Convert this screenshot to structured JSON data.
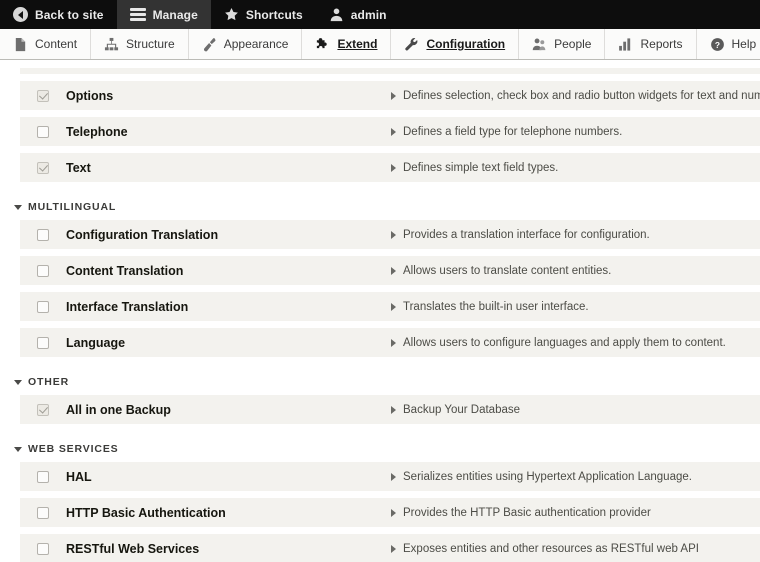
{
  "admin_bar": {
    "items": [
      {
        "label": "Back to site",
        "icon": "back-arrow-icon",
        "active": false
      },
      {
        "label": "Manage",
        "icon": "hamburger-icon",
        "active": true
      },
      {
        "label": "Shortcuts",
        "icon": "star-icon",
        "active": false
      },
      {
        "label": "admin",
        "icon": "user-icon",
        "active": false
      }
    ]
  },
  "tab_bar": {
    "items": [
      {
        "label": "Content",
        "icon": "document-icon",
        "active": false
      },
      {
        "label": "Structure",
        "icon": "sitemap-icon",
        "active": false
      },
      {
        "label": "Appearance",
        "icon": "paintbrush-icon",
        "active": false
      },
      {
        "label": "Extend",
        "icon": "puzzle-piece-icon",
        "active": true
      },
      {
        "label": "Configuration",
        "icon": "wrench-icon",
        "active": true
      },
      {
        "label": "People",
        "icon": "people-icon",
        "active": false
      },
      {
        "label": "Reports",
        "icon": "bar-chart-icon",
        "active": false
      },
      {
        "label": "Help",
        "icon": "question-mark-icon",
        "active": false
      }
    ]
  },
  "colors": {
    "admin_bar_bg": "#0d0d0d",
    "admin_bar_active_bg": "#333333",
    "tab_bar_bg": "#fbfbfa",
    "row_bg": "#f3f2ee",
    "page_bg": "#ffffff"
  },
  "modules": {
    "partial_top_row": true,
    "sections": [
      {
        "header": null,
        "rows": [
          {
            "name": "Options",
            "description": "Defines selection, check box and radio button widgets for text and numeric field",
            "checked": true,
            "disabled": true
          },
          {
            "name": "Telephone",
            "description": "Defines a field type for telephone numbers.",
            "checked": false,
            "disabled": false
          },
          {
            "name": "Text",
            "description": "Defines simple text field types.",
            "checked": true,
            "disabled": true
          }
        ]
      },
      {
        "header": "MULTILINGUAL",
        "rows": [
          {
            "name": "Configuration Translation",
            "description": "Provides a translation interface for configuration.",
            "checked": false,
            "disabled": false
          },
          {
            "name": "Content Translation",
            "description": "Allows users to translate content entities.",
            "checked": false,
            "disabled": false
          },
          {
            "name": "Interface Translation",
            "description": "Translates the built-in user interface.",
            "checked": false,
            "disabled": false
          },
          {
            "name": "Language",
            "description": "Allows users to configure languages and apply them to content.",
            "checked": false,
            "disabled": false
          }
        ]
      },
      {
        "header": "OTHER",
        "rows": [
          {
            "name": "All in one Backup",
            "description": "Backup Your Database",
            "checked": true,
            "disabled": true
          }
        ]
      },
      {
        "header": "WEB SERVICES",
        "rows": [
          {
            "name": "HAL",
            "description": "Serializes entities using Hypertext Application Language.",
            "checked": false,
            "disabled": false
          },
          {
            "name": "HTTP Basic Authentication",
            "description": "Provides the HTTP Basic authentication provider",
            "checked": false,
            "disabled": false
          },
          {
            "name": "RESTful Web Services",
            "description": "Exposes entities and other resources as RESTful web API",
            "checked": false,
            "disabled": false
          }
        ]
      }
    ]
  }
}
